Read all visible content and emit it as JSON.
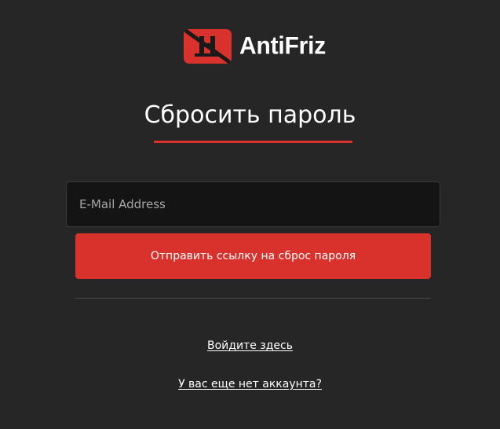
{
  "brand": {
    "name": "AntiFriz",
    "accent_color": "#d9312b",
    "logo_icon": "crossed-out-h-logo-icon"
  },
  "form": {
    "title": "Сбросить пароль",
    "email_placeholder": "E-Mail Address",
    "email_value": "",
    "submit_label": "Отправить ссылку на сброс пароля"
  },
  "links": {
    "login": "Войдите здесь",
    "register": "У вас еще нет аккаунта?"
  },
  "colors": {
    "background": "#262626",
    "input_background": "#141414",
    "text": "#ffffff"
  }
}
